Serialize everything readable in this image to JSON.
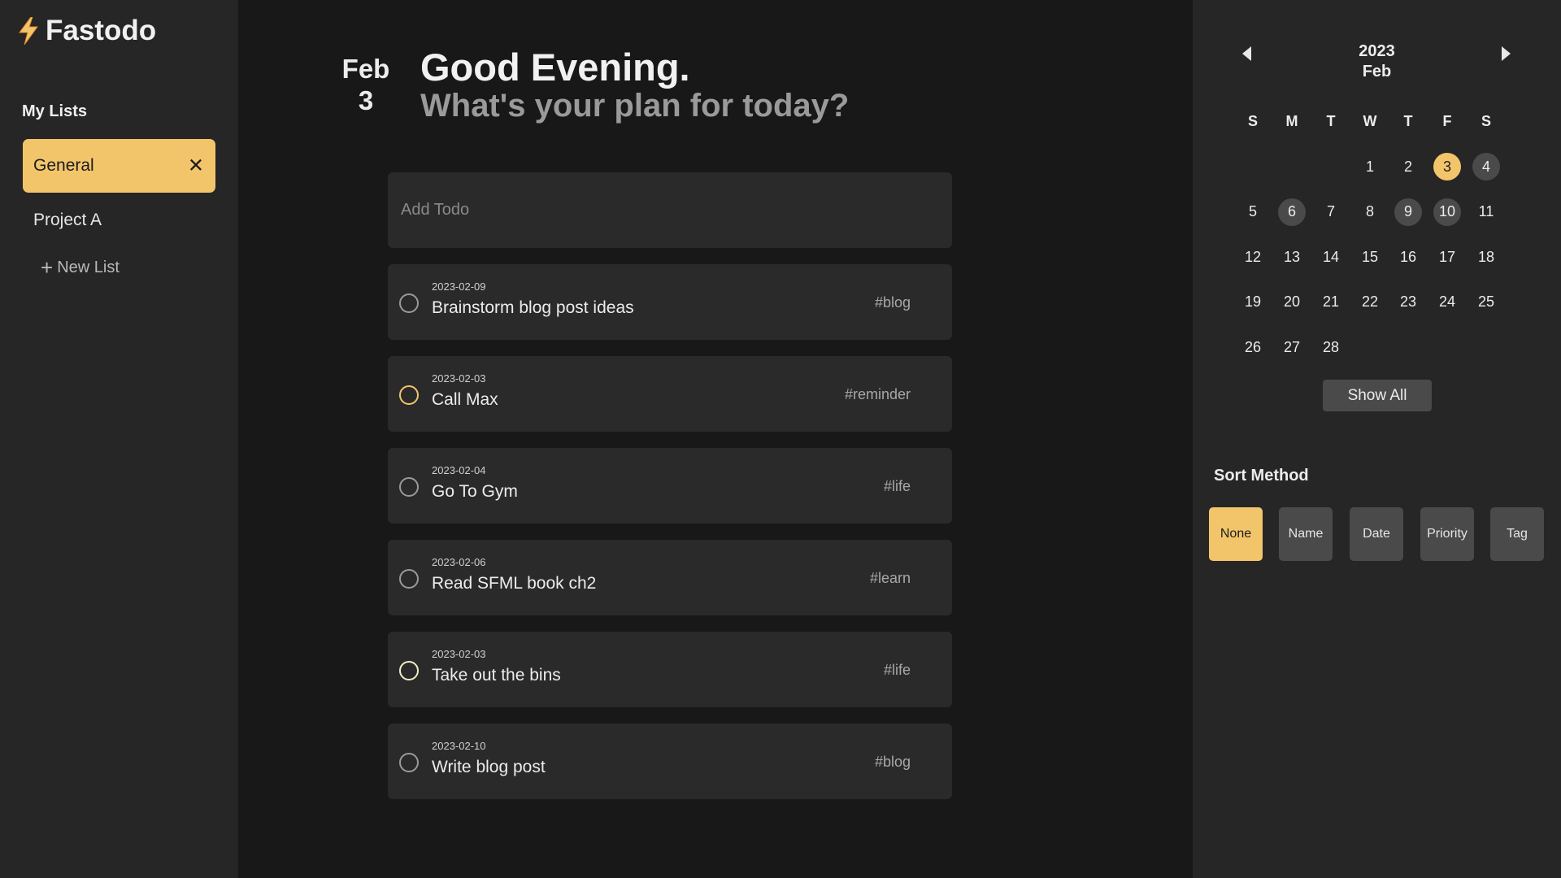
{
  "app": {
    "title": "Fastodo"
  },
  "sidebar": {
    "lists_title": "My Lists",
    "items": [
      {
        "label": "General",
        "active": true
      },
      {
        "label": "Project A",
        "active": false
      }
    ],
    "new_list_label": "New List",
    "close_glyph": "✕",
    "plus_glyph": "+"
  },
  "header": {
    "month": "Feb",
    "day": "3",
    "greeting": "Good Evening.",
    "subtitle": "What's your plan for today?"
  },
  "add_todo": {
    "placeholder": "Add Todo"
  },
  "todos": [
    {
      "date": "2023-02-09",
      "title": "Brainstorm blog post ideas",
      "tag": "#blog",
      "priority": "low"
    },
    {
      "date": "2023-02-03",
      "title": "Call Max",
      "tag": "#reminder",
      "priority": "high"
    },
    {
      "date": "2023-02-04",
      "title": "Go To Gym",
      "tag": "#life",
      "priority": "low"
    },
    {
      "date": "2023-02-06",
      "title": "Read SFML book ch2",
      "tag": "#learn",
      "priority": "low"
    },
    {
      "date": "2023-02-03",
      "title": "Take out the bins",
      "tag": "#life",
      "priority": "medium"
    },
    {
      "date": "2023-02-10",
      "title": "Write blog post",
      "tag": "#blog",
      "priority": "low"
    }
  ],
  "calendar": {
    "year": "2023",
    "month": "Feb",
    "weekdays": [
      "S",
      "M",
      "T",
      "W",
      "T",
      "F",
      "S"
    ],
    "first_weekday": 3,
    "days_in_month": 28,
    "today": 3,
    "days_with_todos": [
      4,
      6,
      9,
      10
    ],
    "show_all_label": "Show All"
  },
  "sort": {
    "title": "Sort Method",
    "options": [
      "None",
      "Name",
      "Date",
      "Priority",
      "Tag"
    ],
    "selected": "None"
  },
  "colors": {
    "accent": "#f3c56b",
    "sidebar_bg": "#262626",
    "main_bg": "#181818",
    "card_bg": "#2a2a2a",
    "muted_badge": "#4a4a4a"
  },
  "icons": {
    "brand": "lightning-bolt-icon",
    "close": "close-icon",
    "add": "plus-icon",
    "prev": "chevron-left-icon",
    "next": "chevron-right-icon",
    "todo_check": "circle-checkbox-icon"
  }
}
